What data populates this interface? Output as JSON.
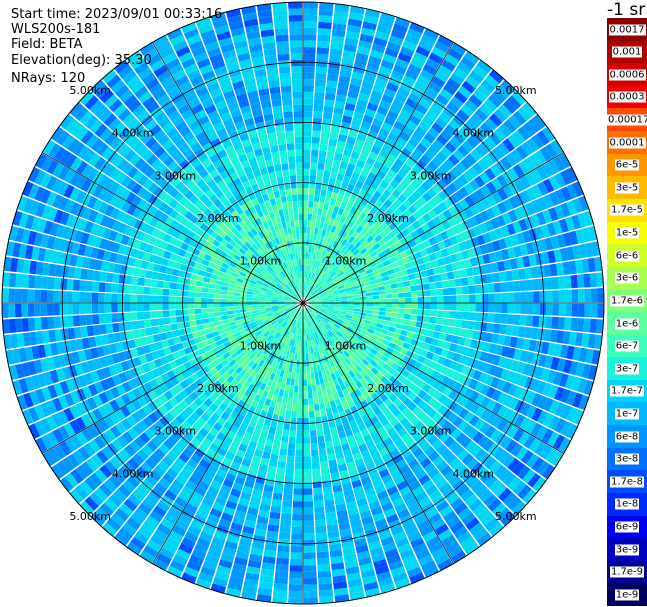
{
  "info": {
    "start_time": "Start time: 2023/09/01 00:33:16",
    "instrument": "WLS200s-181",
    "field": "Field: BETA",
    "elevation": "Elevation(deg): 35.30",
    "nrays": "NRays: 120"
  },
  "colorbar": {
    "title": "-1 sr",
    "entries": [
      {
        "label": "0.0017",
        "color": "#8b0000"
      },
      {
        "label": "0.001",
        "color": "#b00000"
      },
      {
        "label": "0.0006",
        "color": "#d40000"
      },
      {
        "label": "0.0003",
        "color": "#f20000"
      },
      {
        "label": "0.00017",
        "color": "#ff4c00"
      },
      {
        "label": "0.0001",
        "color": "#ff6f00"
      },
      {
        "label": "6e-5",
        "color": "#ff9600"
      },
      {
        "label": "3e-5",
        "color": "#ffbb00"
      },
      {
        "label": "1.7e-5",
        "color": "#ffe000"
      },
      {
        "label": "1e-5",
        "color": "#f5ff00"
      },
      {
        "label": "6e-6",
        "color": "#d0ff27"
      },
      {
        "label": "3e-6",
        "color": "#a8ff4f"
      },
      {
        "label": "1.7e-6",
        "color": "#80ff77"
      },
      {
        "label": "1e-6",
        "color": "#5cff9b"
      },
      {
        "label": "6e-7",
        "color": "#3bffbc"
      },
      {
        "label": "3e-7",
        "color": "#1bf2dc"
      },
      {
        "label": "1.7e-7",
        "color": "#00d7f5"
      },
      {
        "label": "1e-7",
        "color": "#00b8ff"
      },
      {
        "label": "6e-8",
        "color": "#0096ff"
      },
      {
        "label": "3e-8",
        "color": "#0070ff"
      },
      {
        "label": "1.7e-8",
        "color": "#004cff"
      },
      {
        "label": "1e-8",
        "color": "#0028ff"
      },
      {
        "label": "6e-9",
        "color": "#0000f0"
      },
      {
        "label": "3e-9",
        "color": "#0000c0"
      },
      {
        "label": "1.7e-9",
        "color": "#000090"
      },
      {
        "label": "1e-9",
        "color": "#000060"
      }
    ]
  },
  "chart_data": {
    "type": "heatmap",
    "projection": "polar",
    "field": "BETA",
    "nrays": 120,
    "range_rings_km": [
      1,
      2,
      3,
      4,
      5
    ],
    "ring_labels": [
      "1.00km",
      "2.00km",
      "3.00km",
      "4.00km",
      "5.00km"
    ],
    "max_range_km": 5.0,
    "spokes_deg": [
      0,
      30,
      60,
      90,
      120,
      150,
      180,
      210,
      240,
      270,
      300,
      330
    ],
    "color_scale": "log",
    "value_range": [
      1e-09,
      0.0017
    ],
    "dominant_values": {
      "center": "1.7e-6 to 3e-7",
      "near_1_2km": "6e-7 to 3e-7",
      "far_3_5km": "1e-7 to 3e-8"
    }
  }
}
